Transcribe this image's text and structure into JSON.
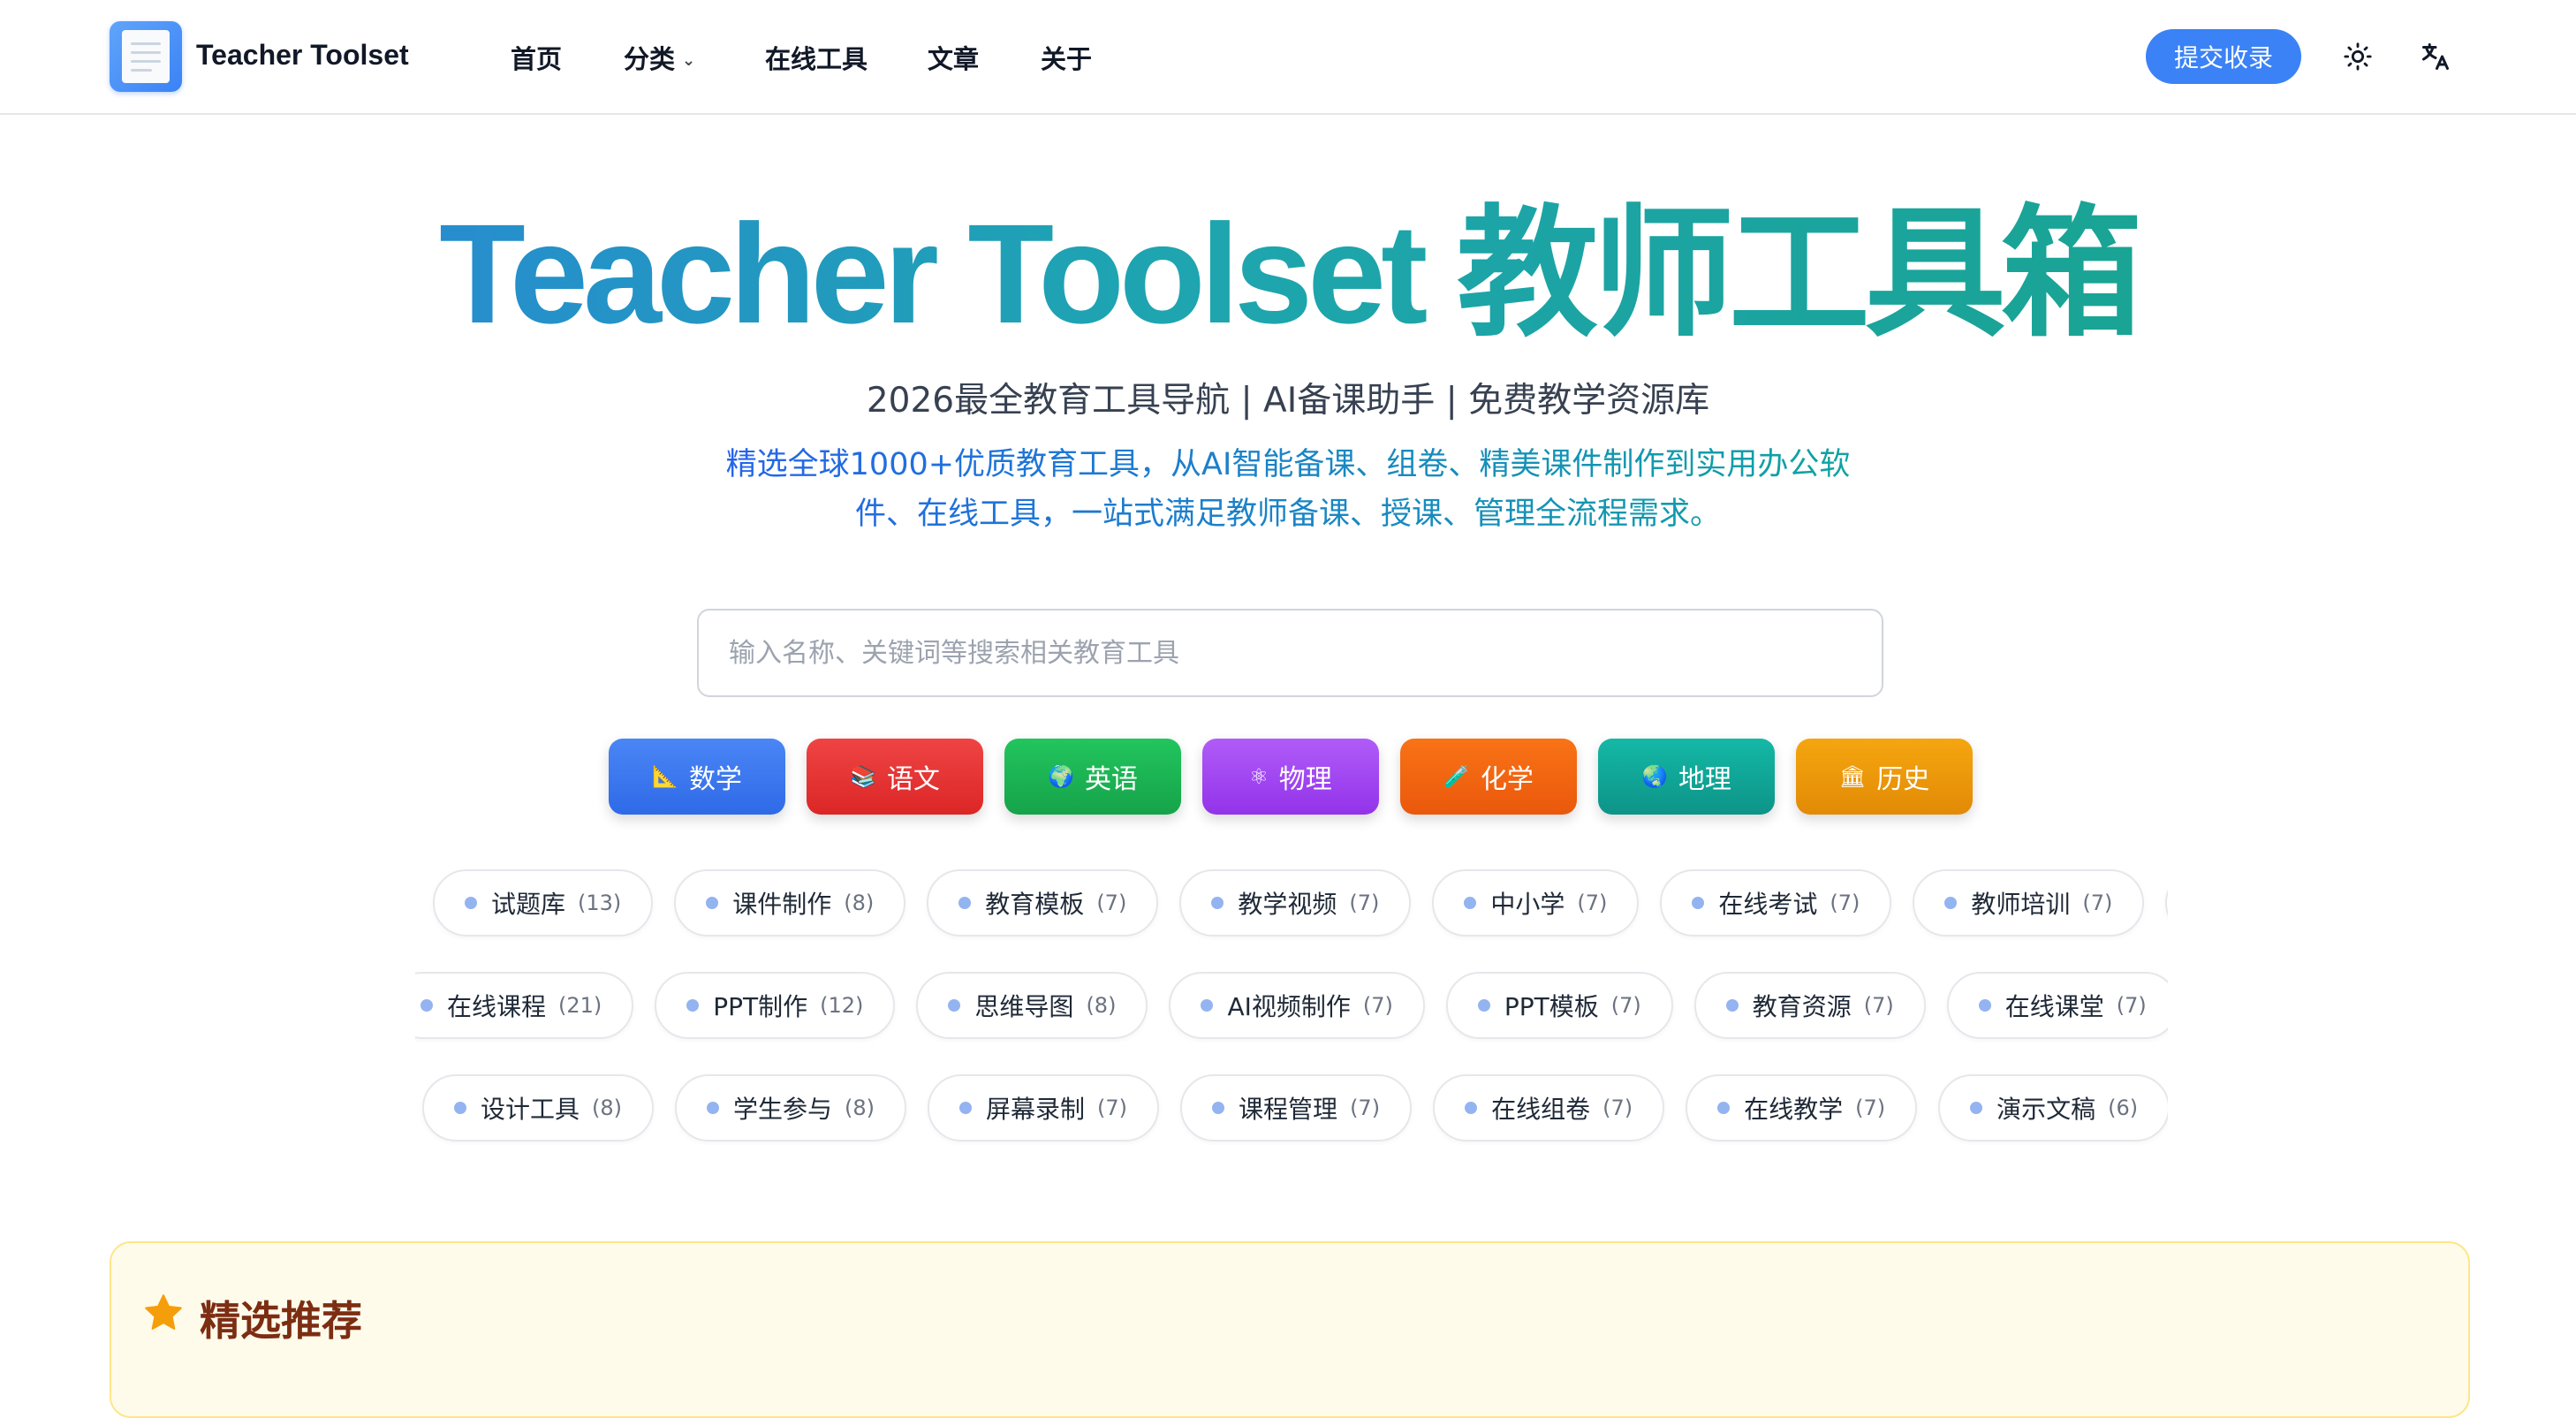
{
  "header": {
    "brand": "Teacher Toolset",
    "menu": [
      {
        "label": "首页"
      },
      {
        "label": "分类",
        "has_dropdown": true
      },
      {
        "label": "在线工具"
      },
      {
        "label": "文章"
      },
      {
        "label": "关于"
      }
    ],
    "submit_label": "提交收录",
    "icons": [
      "sun-icon",
      "translate-icon"
    ]
  },
  "hero": {
    "title": "Teacher Toolset 教师工具箱",
    "subtitle": "2026最全教育工具导航 | AI备课助手 | 免费教学资源库",
    "desc_line1": "精选全球1000+优质教育工具，从AI智能备课、组卷、精美课件制作到实用办公软",
    "desc_line2": "件、在线工具，一站式满足教师备课、授课、管理全流程需求。"
  },
  "search": {
    "placeholder": "输入名称、关键词等搜索相关教育工具",
    "value": ""
  },
  "subjects": [
    {
      "emoji": "📐",
      "label": "数学",
      "color": "#3b7af0"
    },
    {
      "emoji": "📚",
      "label": "语文",
      "color": "#e53e3e"
    },
    {
      "emoji": "🌍",
      "label": "英语",
      "color": "#22b45a"
    },
    {
      "emoji": "⚛",
      "label": "物理",
      "color": "#a855f7"
    },
    {
      "emoji": "🧪",
      "label": "化学",
      "color": "#f56b18"
    },
    {
      "emoji": "🌏",
      "label": "地理",
      "color": "#14ad98"
    },
    {
      "emoji": "🏛",
      "label": "历史",
      "color": "#f0a00c"
    }
  ],
  "tag_rows": [
    [
      {
        "label": "试题库",
        "count": "(13)"
      },
      {
        "label": "课件制作",
        "count": "(8)"
      },
      {
        "label": "教育模板",
        "count": "(7)"
      },
      {
        "label": "教学视频",
        "count": "(7)"
      },
      {
        "label": "中小学",
        "count": "(7)"
      },
      {
        "label": "在线考试",
        "count": "(7)"
      },
      {
        "label": "教师培训",
        "count": "(7)"
      }
    ],
    [
      {
        "label": "在线课程",
        "count": "(21)"
      },
      {
        "label": "PPT制作",
        "count": "(12)"
      },
      {
        "label": "思维导图",
        "count": "(8)"
      },
      {
        "label": "AI视频制作",
        "count": "(7)"
      },
      {
        "label": "PPT模板",
        "count": "(7)"
      },
      {
        "label": "教育资源",
        "count": "(7)"
      },
      {
        "label": "在线课堂",
        "count": "(7)"
      }
    ],
    [
      {
        "label": "设计工具",
        "count": "(8)"
      },
      {
        "label": "学生参与",
        "count": "(8)"
      },
      {
        "label": "屏幕录制",
        "count": "(7)"
      },
      {
        "label": "课程管理",
        "count": "(7)"
      },
      {
        "label": "在线组卷",
        "count": "(7)"
      },
      {
        "label": "在线教学",
        "count": "(7)"
      },
      {
        "label": "演示文稿",
        "count": "(6)"
      }
    ]
  ],
  "featured": {
    "title": "精选推荐",
    "icon": "star-icon"
  },
  "colors": {
    "primary": "#3b82f6",
    "tag_dot": "#93b4f0",
    "featured_bg": "#fffbeb"
  }
}
